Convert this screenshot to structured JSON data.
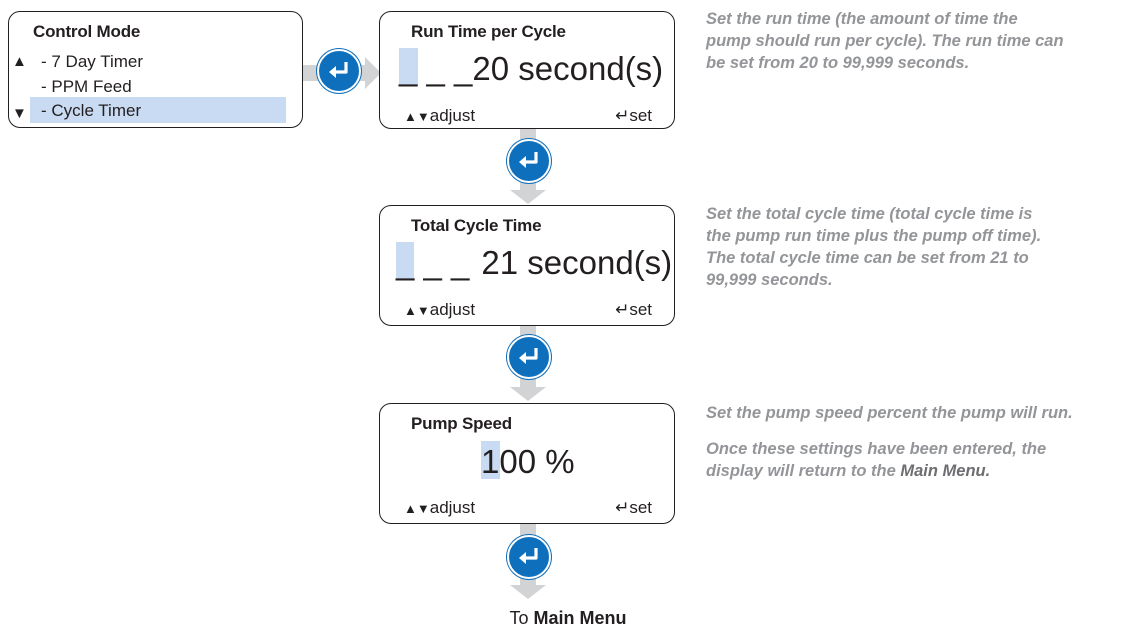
{
  "control_mode": {
    "title": "Control Mode",
    "items": [
      "- 7 Day Timer",
      "- PPM Feed",
      "- Cycle Timer"
    ],
    "selected_index": 2
  },
  "run_time": {
    "title": "Run Time per Cycle",
    "placeholder": "_ _ _",
    "value": "20 second(s)",
    "adjust": "adjust",
    "set": "set",
    "description": "Set the run time (the amount of time the pump should run per cycle). The run time can be set from 20 to 99,999 seconds."
  },
  "total_cycle": {
    "title": "Total Cycle Time",
    "placeholder": "_ _ _",
    "value": "21 second(s)",
    "adjust": "adjust",
    "set": "set",
    "description": "Set the total cycle time (total cycle time is the pump run time plus the pump off time). The total cycle time can be set from 21 to 99,999 seconds."
  },
  "pump_speed": {
    "title": "Pump Speed",
    "value_first": "1",
    "value_rest": "00 %",
    "adjust": "adjust",
    "set": "set",
    "description_1": "Set the pump speed percent the pump will run.",
    "description_2": "Once these settings have been entered, the display will return to the",
    "description_2_bold": "Main Menu."
  },
  "footer": {
    "prefix": "To",
    "target": "Main Menu"
  },
  "colors": {
    "enter_button": "#0e6fbc",
    "highlight": "#c8dbf2",
    "arrow": "#d2d3d5",
    "description_text": "#939598"
  },
  "icons": [
    "enter-icon",
    "up-triangle-icon",
    "down-triangle-icon",
    "return-arrow-icon"
  ]
}
